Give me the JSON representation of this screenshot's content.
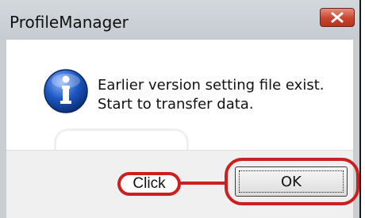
{
  "dialog": {
    "title": "ProfileManager",
    "message_line1": "Earlier version setting file exist.",
    "message_line2": "Start to transfer data.",
    "icon": "info-icon",
    "ok_label": "OK"
  },
  "annotation": {
    "label": "Click",
    "color": "#cc1f1f"
  },
  "colors": {
    "close_button": "#c8442f",
    "info_icon": "#1d58c4"
  }
}
